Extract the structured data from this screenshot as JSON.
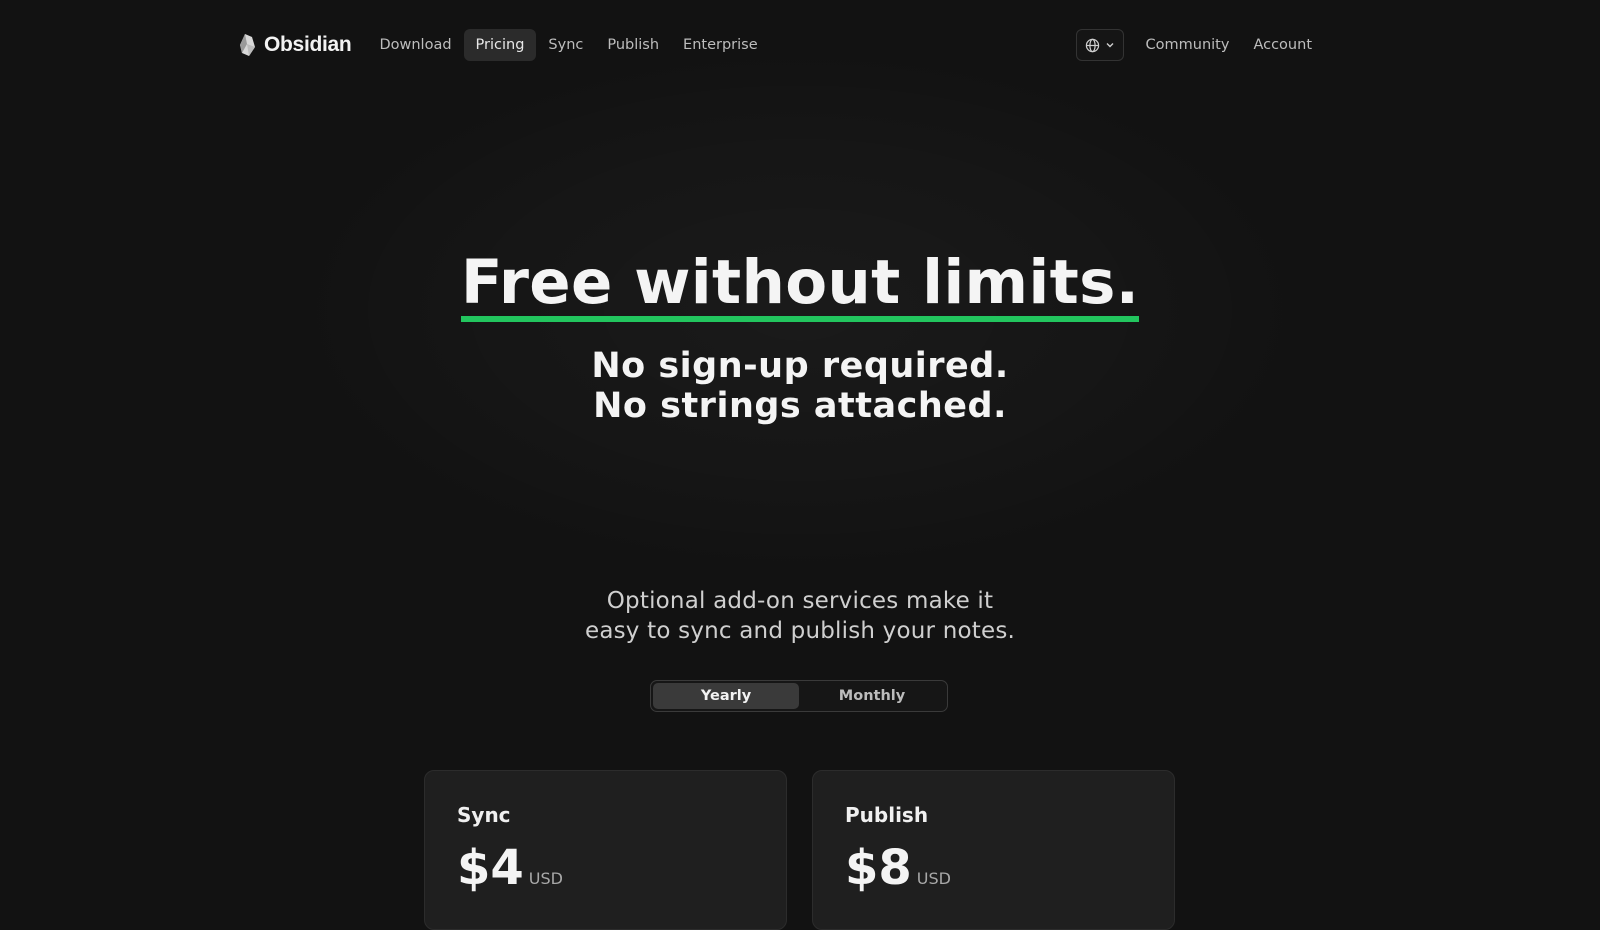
{
  "nav": {
    "brand": "Obsidian",
    "links": [
      "Download",
      "Pricing",
      "Sync",
      "Publish",
      "Enterprise"
    ],
    "active": "Pricing",
    "right_links": [
      "Community",
      "Account"
    ],
    "language_icon": "globe-icon"
  },
  "hero": {
    "title": "Free without limits.",
    "subtitle_line1": "No sign-up required.",
    "subtitle_line2": "No strings attached.",
    "underline_color": "#22c55e"
  },
  "addon": {
    "line1": "Optional add-on services make it",
    "line2": "easy to sync and publish your notes."
  },
  "billing_toggle": {
    "options": [
      "Yearly",
      "Monthly"
    ],
    "selected": "Yearly"
  },
  "plans": [
    {
      "name": "Sync",
      "price": "$4",
      "currency": "USD"
    },
    {
      "name": "Publish",
      "price": "$8",
      "currency": "USD"
    }
  ]
}
